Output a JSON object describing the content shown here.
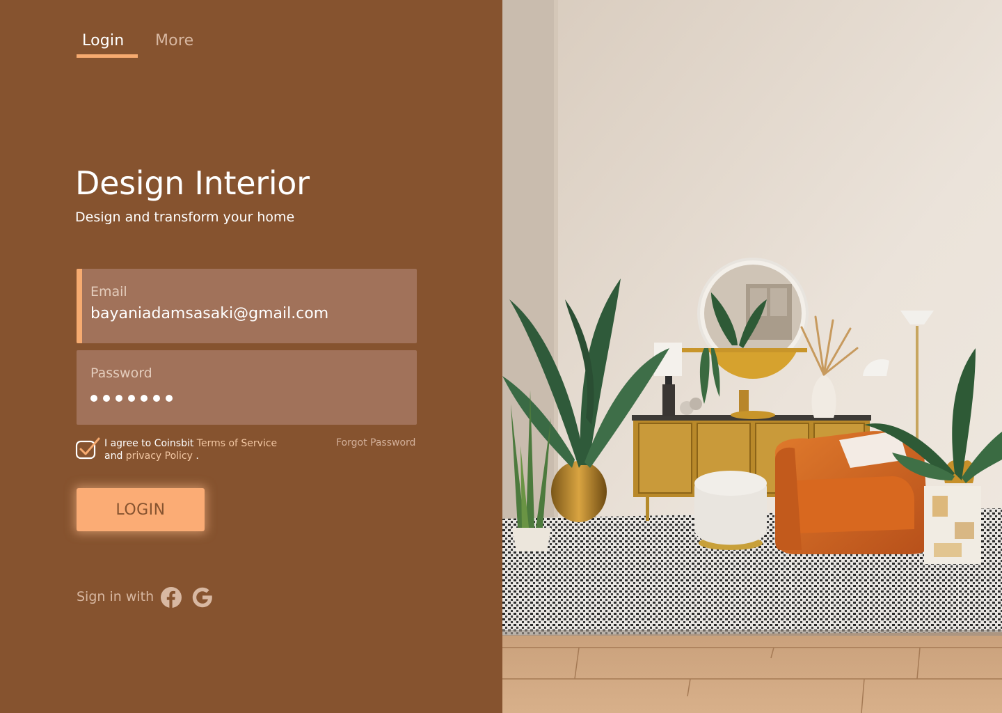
{
  "tabs": [
    {
      "label": "Login",
      "active": true
    },
    {
      "label": "More",
      "active": false
    }
  ],
  "hero": {
    "title": "Design Interior",
    "subtitle": "Design and transform your home"
  },
  "form": {
    "email": {
      "label": "Email",
      "value": "bayaniadamsasaki@gmail.com"
    },
    "password": {
      "label": "Password",
      "masked_length": 7
    },
    "agree": {
      "checked": true,
      "text_prefix": "I agree to Coinsbit ",
      "terms_link": "Terms of Service",
      "text_and": "and ",
      "privacy_link": "privacy Policy",
      "text_suffix": " ."
    },
    "forgot_password": "Forgot Password",
    "login_button": "LOGIN"
  },
  "social": {
    "label": "Sign in with",
    "providers": [
      "facebook-icon",
      "google-icon"
    ]
  },
  "colors": {
    "panel": "#86532f",
    "accent": "#f7ab70",
    "field": "#a1725a",
    "button": "#fbac75"
  }
}
